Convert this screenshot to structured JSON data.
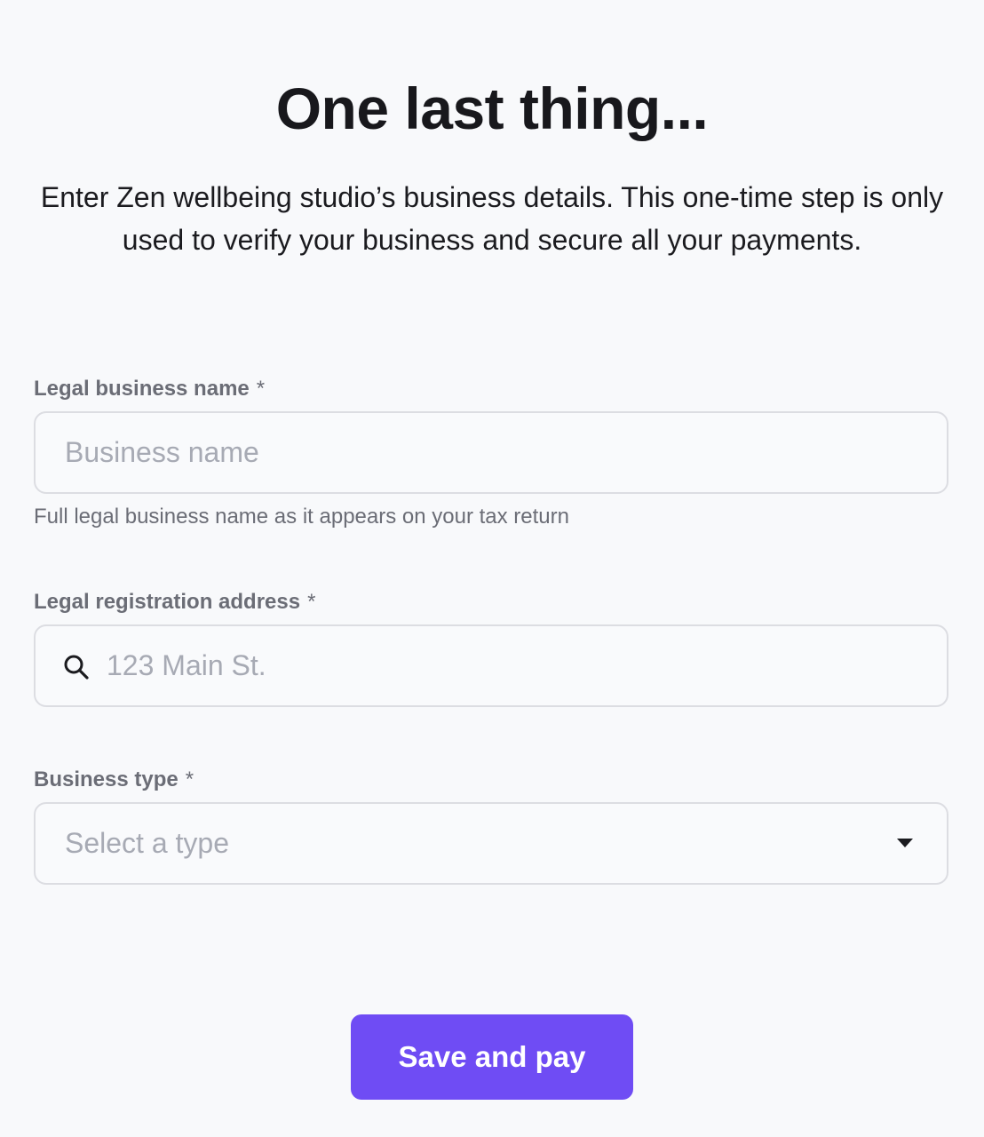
{
  "header": {
    "title": "One last thing..."
  },
  "intro": {
    "text": "Enter Zen wellbeing studio’s business details. This one-time step is only used to verify your business and secure all your payments."
  },
  "form": {
    "business_name": {
      "label": "Legal business name",
      "required_marker": "*",
      "placeholder": "Business name",
      "value": "",
      "hint": "Full legal business name as it appears on your tax return"
    },
    "address": {
      "label": "Legal registration address",
      "required_marker": "*",
      "placeholder": "123 Main St.",
      "value": "",
      "icon": "search-icon"
    },
    "business_type": {
      "label": "Business type",
      "required_marker": "*",
      "selected": "Select a type",
      "icon": "caret-down-icon"
    },
    "submit_label": "Save and pay"
  },
  "colors": {
    "accent": "#6f4cf4",
    "background": "#f8f9fb",
    "label": "#6b6d76",
    "placeholder": "#a7aab4",
    "border": "#dcdde2"
  }
}
